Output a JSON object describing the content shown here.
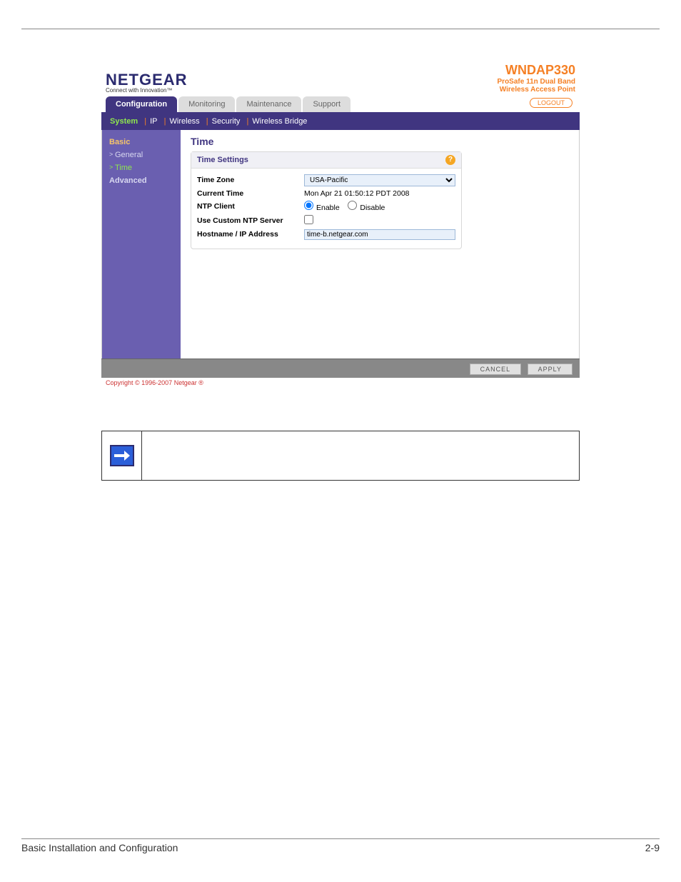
{
  "logo": {
    "main": "NETGEAR",
    "tag": "Connect with Innovation™"
  },
  "product": {
    "name": "WNDAP330",
    "sub1": "ProSafe 11n Dual Band",
    "sub2": "Wireless Access Point"
  },
  "tabs": [
    "Configuration",
    "Monitoring",
    "Maintenance",
    "Support"
  ],
  "logout": "LOGOUT",
  "subnav": [
    "System",
    "IP",
    "Wireless",
    "Security",
    "Wireless Bridge"
  ],
  "sidebar": {
    "section1": "Basic",
    "items1": [
      "General",
      "Time"
    ],
    "section2": "Advanced"
  },
  "main": {
    "title": "Time",
    "panel_title": "Time Settings",
    "rows": {
      "tz_label": "Time Zone",
      "tz_value": "USA-Pacific",
      "ct_label": "Current Time",
      "ct_value": "Mon Apr 21 01:50:12 PDT 2008",
      "ntp_label": "NTP Client",
      "ntp_enable": "Enable",
      "ntp_disable": "Disable",
      "custom_label": "Use Custom NTP Server",
      "host_label": "Hostname / IP Address",
      "host_value": "time-b.netgear.com"
    }
  },
  "footer": {
    "cancel": "CANCEL",
    "apply": "APPLY"
  },
  "copyright": "Copyright © 1996-2007 Netgear ®",
  "page_footer": {
    "left": "Basic Installation and Configuration",
    "right": "2-9"
  }
}
